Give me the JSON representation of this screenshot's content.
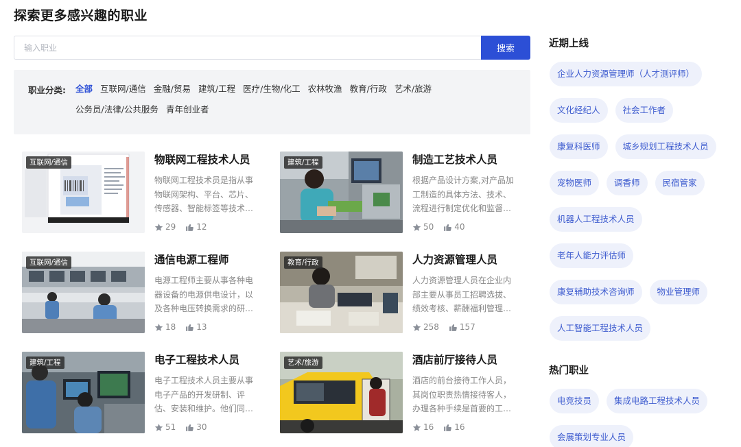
{
  "page": {
    "title": "探索更多感兴趣的职业"
  },
  "search": {
    "placeholder": "输入职业",
    "button_label": "搜索"
  },
  "filter": {
    "label": "职业分类:",
    "items": [
      "全部",
      "互联网/通信",
      "金融/贸易",
      "建筑/工程",
      "医疗/生物/化工",
      "农林牧渔",
      "教育/行政",
      "艺术/旅游",
      "公务员/法律/公共服务",
      "青年创业者"
    ],
    "active": "全部"
  },
  "cards": [
    {
      "tag": "互联网/通信",
      "title": "物联网工程技术人员",
      "desc": "物联网工程技术员是指从事物联网架构、平台、芯片、传感器、智能标签等技术…",
      "stars": "29",
      "likes": "12"
    },
    {
      "tag": "建筑/工程",
      "title": "制造工艺技术人员",
      "desc": "根据产品设计方案,对产品加工制造的具体方法、技术、流程进行制定优化和监督…",
      "stars": "50",
      "likes": "40"
    },
    {
      "tag": "互联网/通信",
      "title": "通信电源工程师",
      "desc": "电源工程师主要从事各种电器设备的电源供电设计，以及各种电压转换需求的研…",
      "stars": "18",
      "likes": "13"
    },
    {
      "tag": "教育/行政",
      "title": "人力资源管理人员",
      "desc": "人力资源管理人员在企业内部主要从事员工招聘选拔、绩效考核、薪酬福利管理…",
      "stars": "258",
      "likes": "157"
    },
    {
      "tag": "建筑/工程",
      "title": "电子工程技术人员",
      "desc": "电子工程技术人员主要从事电子产品的开发研制、评估、安装和维护。他们同…",
      "stars": "51",
      "likes": "30"
    },
    {
      "tag": "艺术/旅游",
      "title": "酒店前厅接待人员",
      "desc": "酒店的前台接待工作人员，其岗位职责热情接待客人，办理各种手续是首要的工…",
      "stars": "16",
      "likes": "16"
    }
  ],
  "sidebar": {
    "recent_title": "近期上线",
    "recent": [
      "企业人力资源管理师（人才测评师）",
      "文化经纪人",
      "社会工作者",
      "康复科医师",
      "城乡规划工程技术人员",
      "宠物医师",
      "调香师",
      "民宿管家",
      "机器人工程技术人员",
      "老年人能力评估师",
      "康复辅助技术咨询师",
      "物业管理师",
      "人工智能工程技术人员"
    ],
    "hot_title": "热门职业",
    "hot": [
      "电竞技员",
      "集成电路工程技术人员",
      "会展策划专业人员"
    ]
  },
  "colors": {
    "accent": "#2c4fd6",
    "chip_bg": "#eef1fb",
    "chip_text": "#3e5ccf",
    "filter_bg": "#f3f4f6"
  }
}
